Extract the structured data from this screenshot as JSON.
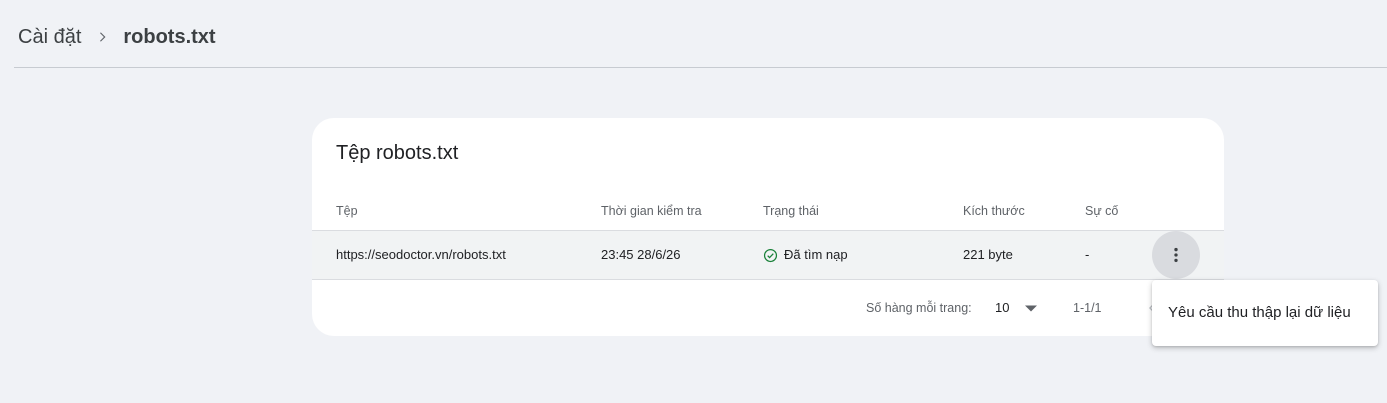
{
  "breadcrumb": {
    "parent": "Cài đặt",
    "current": "robots.txt"
  },
  "card": {
    "title": "Tệp robots.txt",
    "columns": [
      "Tệp",
      "Thời gian kiểm tra",
      "Trạng thái",
      "Kích thước",
      "Sự cố"
    ],
    "rows": [
      {
        "file": "https://seodoctor.vn/robots.txt",
        "checked": "23:45 28/6/26",
        "status": "Đã tìm nạp",
        "size": "221 byte",
        "issues": "-"
      }
    ],
    "pagination": {
      "rows_per_page_label": "Số hàng mỗi trang:",
      "rows_per_page": "10",
      "range": "1-1/1"
    }
  },
  "menu": {
    "items": [
      "Yêu cầu thu thập lại dữ liệu"
    ]
  },
  "colors": {
    "background": "#f0f2f6",
    "card": "#ffffff",
    "row_highlight": "#f1f3f4",
    "success": "#188038"
  },
  "icons": {
    "breadcrumb_separator": "chevron-right-icon",
    "status": "check-circle-icon",
    "more": "more-vert-icon",
    "dropdown": "arrow-drop-down-icon",
    "prev": "chevron-left-icon"
  }
}
